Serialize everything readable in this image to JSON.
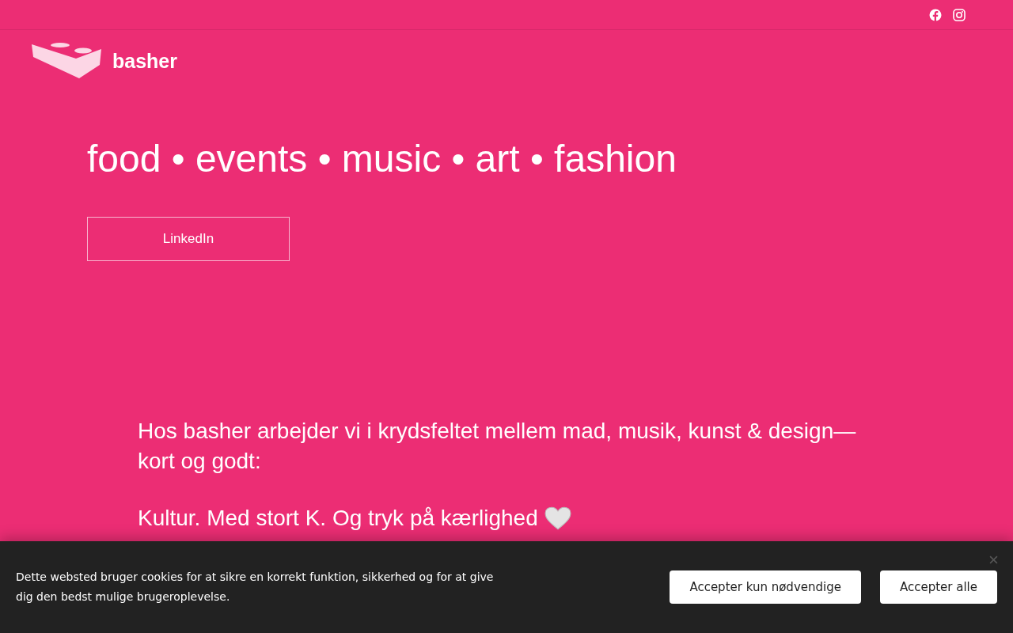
{
  "brand": {
    "name": "basher"
  },
  "hero": {
    "headline": "food • events • music • art • fashion",
    "button": "LinkedIn"
  },
  "intro": {
    "paragraphs": [
      "Hos basher arbejder vi i krydsfeltet mellem mad, musik, kunst & design—kort og godt:",
      "Kultur. Med stort K. Og tryk på kærlighed"
    ]
  },
  "cookie_banner": {
    "text": "Dette websted bruger cookies for at sikre en korrekt funktion, sikkerhed og for at give dig den bedst mulige brugeroplevelse.",
    "buttons": [
      "Accepter kun nødvendige",
      "Accepter alle"
    ]
  }
}
